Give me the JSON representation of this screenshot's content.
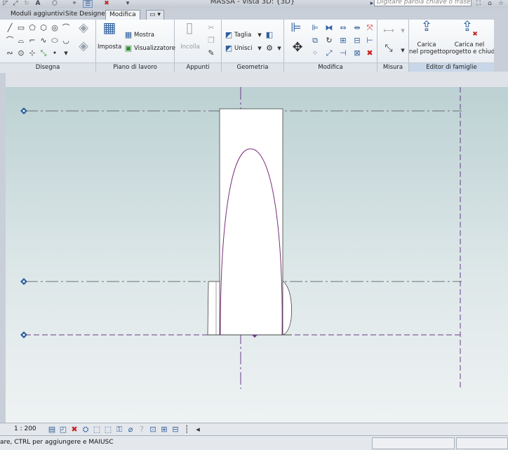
{
  "window": {
    "title": "MASSA - Vista 3D: {3D}",
    "search_placeholder": "Digitare parola chiave o frase"
  },
  "tabs": [
    {
      "label": "Moduli aggiuntivi",
      "active": false
    },
    {
      "label": "Site Designer",
      "active": false
    },
    {
      "label": "Modifica",
      "active": true
    }
  ],
  "ribbon": {
    "panels": {
      "disegna": "Disegna",
      "piano": "Piano di lavoro",
      "appunti": "Appunti",
      "geometria": "Geometria",
      "modifica": "Modifica",
      "misura": "Misura",
      "editor": "Editor di famiglie"
    },
    "buttons": {
      "imposta": "Imposta",
      "mostra": "Mostra",
      "visualizzatore": "Visualizzatore",
      "incolla": "Incolla",
      "taglia": "Taglia",
      "unisci": "Unisci",
      "carica_line1": "Carica",
      "carica_line2": "nel progetto",
      "carica_chiudi_line1": "Carica nel",
      "carica_chiudi_line2": "progetto e chiudi"
    }
  },
  "viewbar": {
    "scale": "1 : 200"
  },
  "status": {
    "text": "are, CTRL per aggiungere e MAIUSC"
  },
  "colors": {
    "accent": "#2f5f9e",
    "reference_line": "#6a6f76",
    "curve": "#7a2f7a",
    "dashed_violet": "#6b3a8c"
  }
}
